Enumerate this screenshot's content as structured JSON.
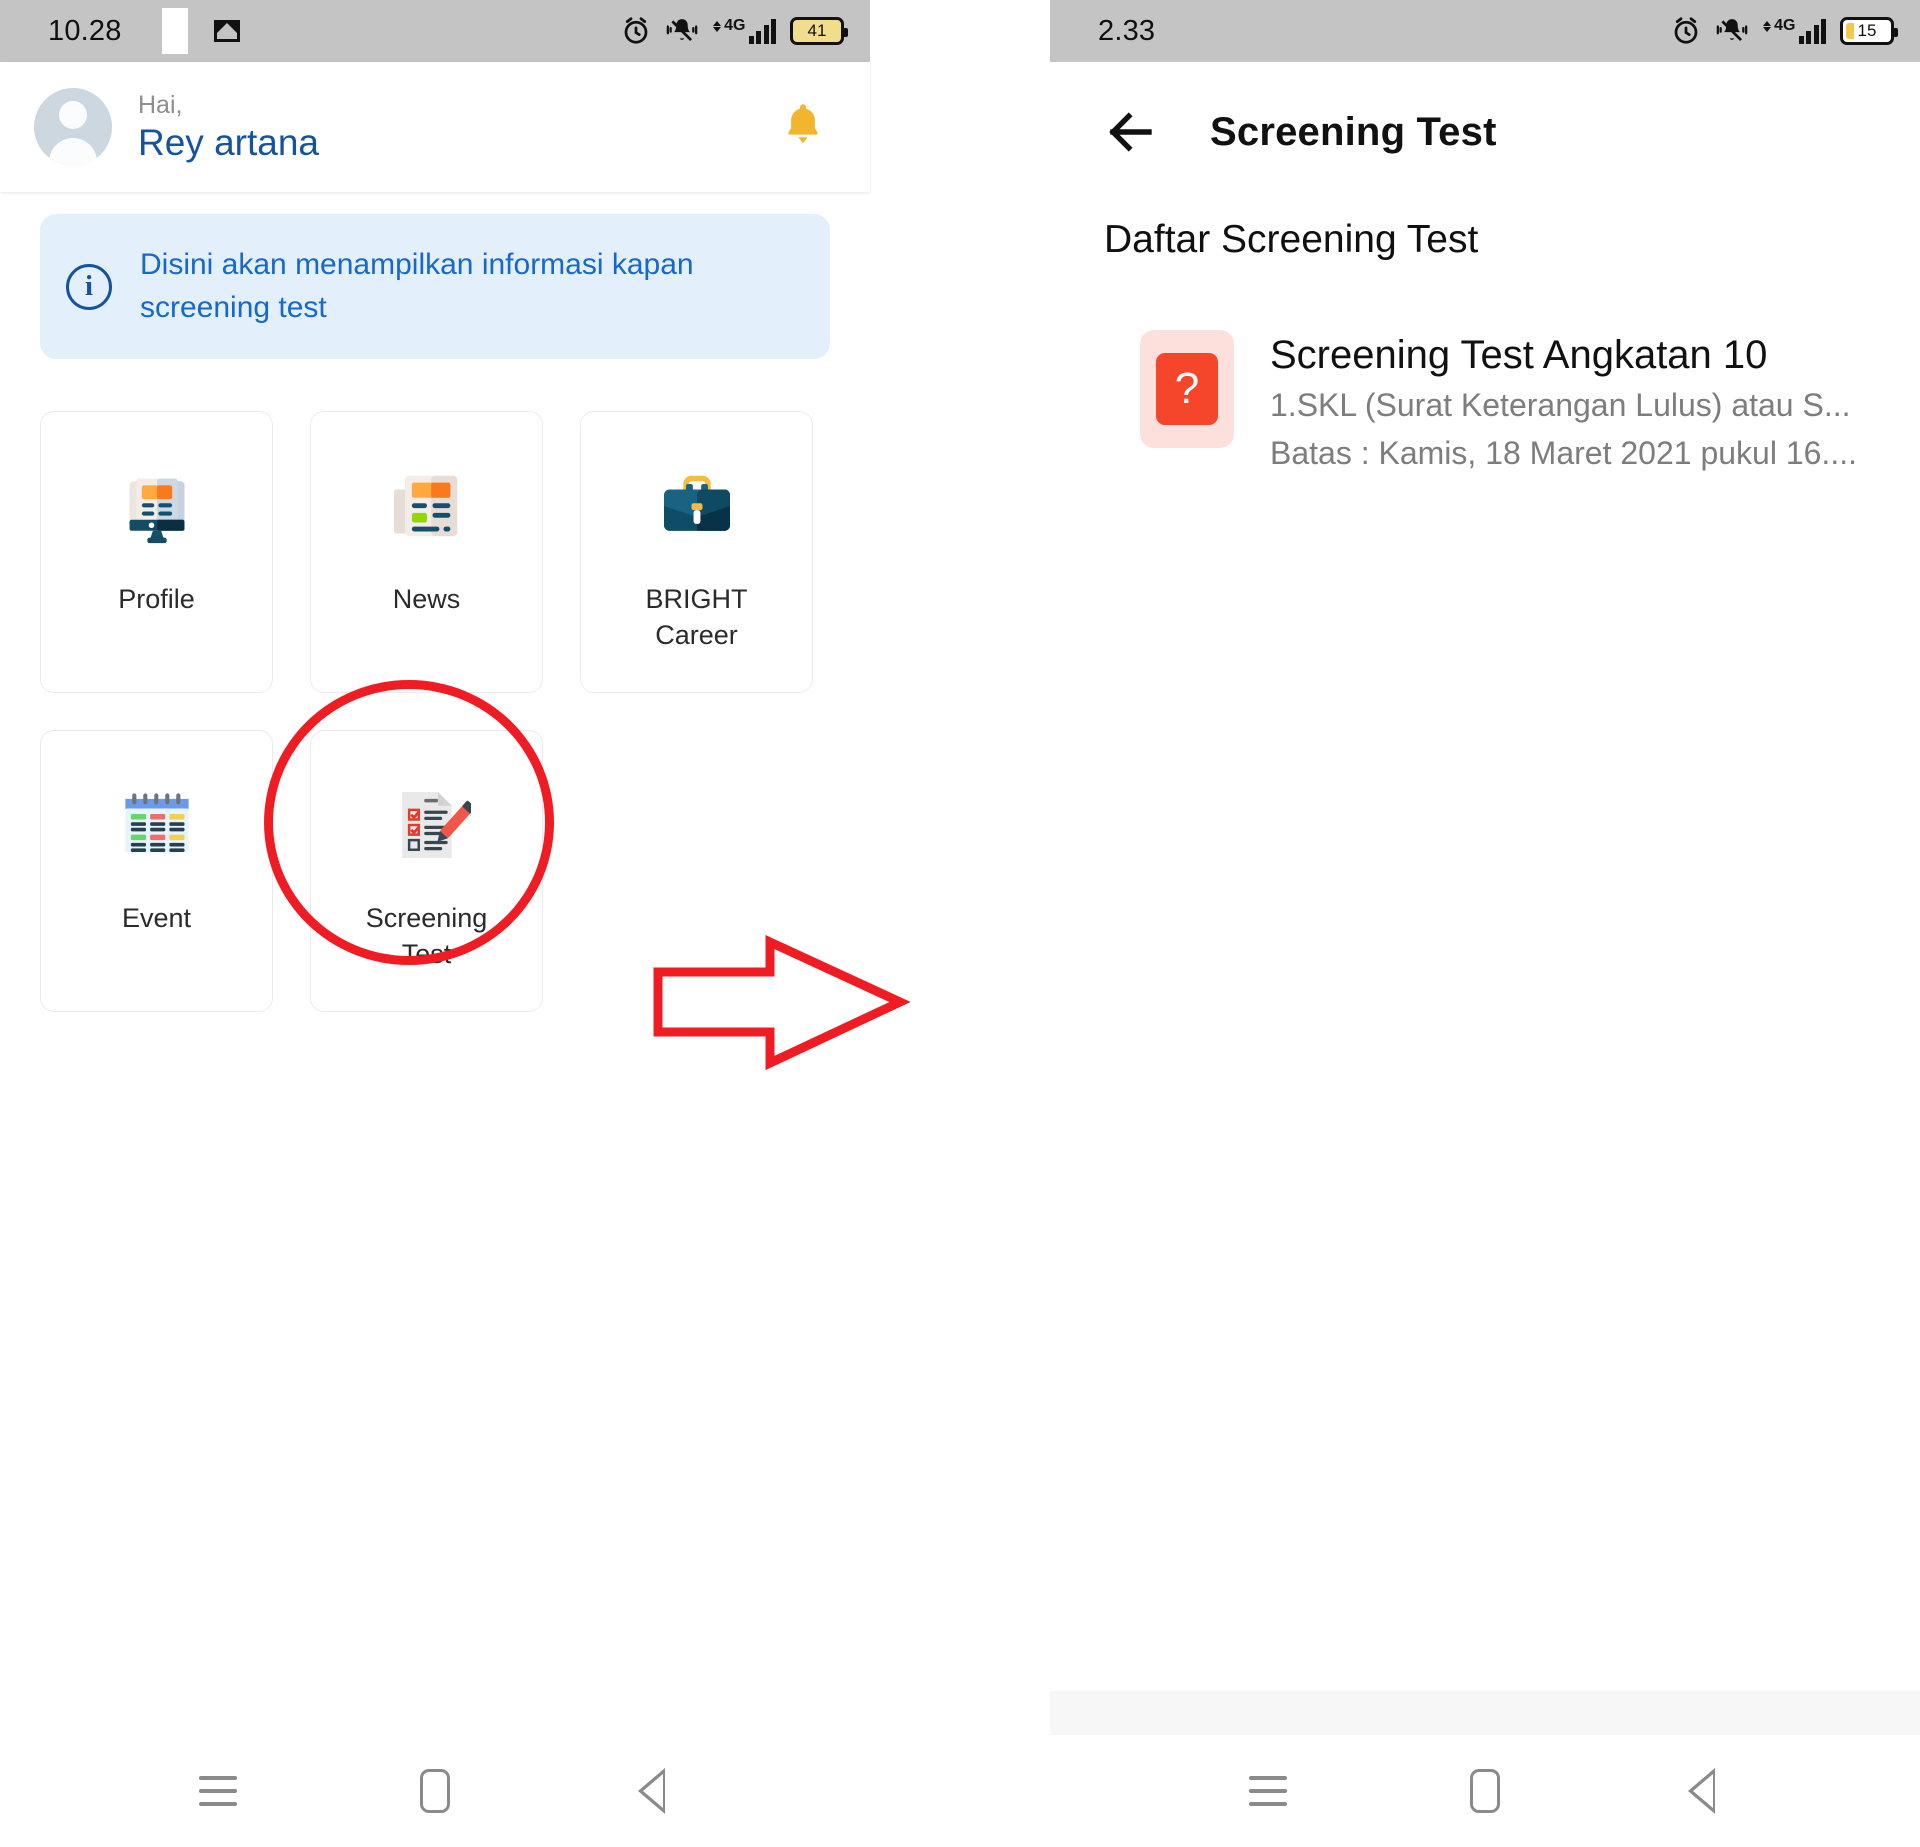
{
  "left_phone": {
    "status_bar": {
      "time": "10.28",
      "icons": [
        "gmail-icon",
        "alarm-icon",
        "bell-off-icon",
        "network-4g-icon",
        "signal-bars-icon",
        "battery-icon"
      ],
      "network_label": "4G",
      "battery_level": "41"
    },
    "header": {
      "greeting": "Hai,",
      "user_name": "Rey artana",
      "avatar_icon": "person-avatar",
      "bell_icon": "notification-bell-icon",
      "bell_color": "#f2b52e"
    },
    "info_banner": {
      "icon": "info-circle-icon",
      "icon_glyph": "i",
      "text": "Disini akan menampilkan informasi kapan screening test",
      "background": "#e3f0fb",
      "text_color": "#1668c9"
    },
    "tiles": [
      {
        "label": "Profile",
        "icon": "desktop-monitor-icon"
      },
      {
        "label": "News",
        "icon": "newspaper-icon"
      },
      {
        "label": "BRIGHT\nCareer",
        "icon": "briefcase-icon"
      },
      {
        "label": "Event",
        "icon": "calendar-icon"
      },
      {
        "label": "Screening\nTest",
        "icon": "checklist-pencil-icon"
      }
    ],
    "nav_bar": {
      "menu_icon": "menu-recents-icon",
      "home_icon": "home-icon",
      "back_icon": "back-triangle-icon"
    }
  },
  "annotations": {
    "highlight_ellipse": {
      "shape": "ellipse",
      "color": "#ef1c24",
      "target": "Screening Test"
    },
    "flow_arrow": {
      "shape": "arrow-right",
      "color": "#ef1c24"
    }
  },
  "right_phone": {
    "status_bar": {
      "time": "2.33",
      "icons": [
        "alarm-icon",
        "bell-off-icon",
        "network-4g-icon",
        "signal-bars-icon",
        "battery-icon"
      ],
      "network_label": "4G",
      "battery_level": "15"
    },
    "app_bar": {
      "back_icon": "arrow-left-icon",
      "title": "Screening Test"
    },
    "section_title": "Daftar Screening Test",
    "list": [
      {
        "icon": "question-mark-icon",
        "icon_bg": "#fde0dc",
        "icon_fg": "#f5462b",
        "title": "Screening Test Angkatan 10",
        "subtitle": "1.SKL (Surat Keterangan Lulus) atau S...",
        "deadline": "Batas : Kamis, 18 Maret 2021 pukul 16...."
      }
    ],
    "nav_bar": {
      "menu_icon": "menu-recents-icon",
      "home_icon": "home-icon",
      "back_icon": "back-triangle-icon"
    }
  }
}
